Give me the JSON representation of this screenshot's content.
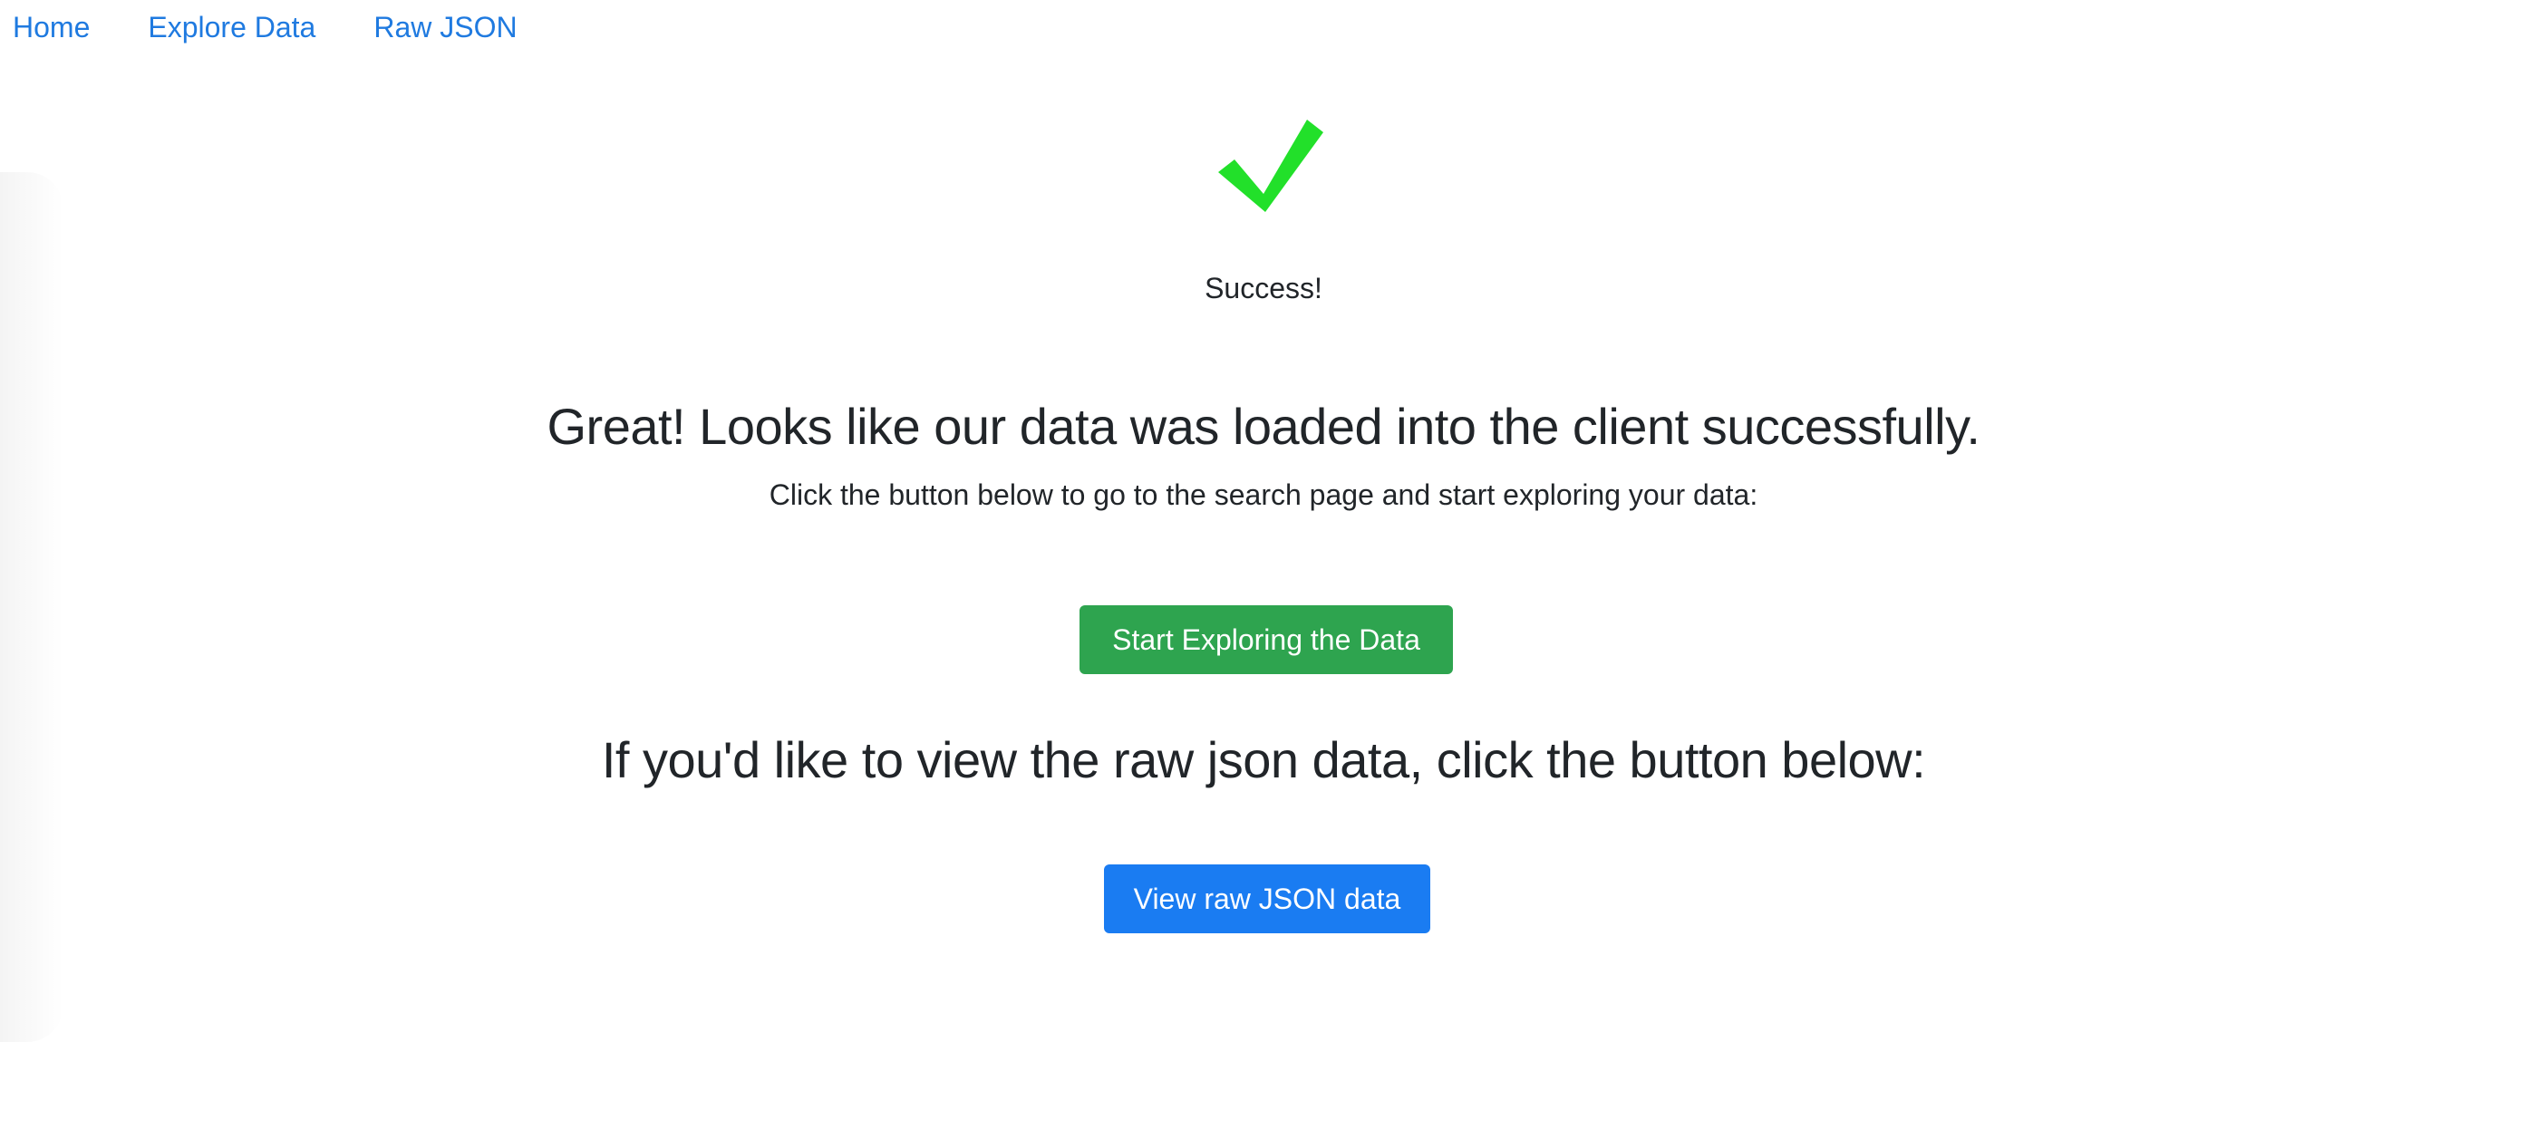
{
  "nav": {
    "items": [
      {
        "label": "Home"
      },
      {
        "label": "Explore Data"
      },
      {
        "label": "Raw JSON"
      }
    ]
  },
  "status": {
    "icon": "checkmark-icon",
    "icon_color": "#22e02a",
    "text": "Success!"
  },
  "main": {
    "headline": "Great! Looks like our data was loaded into the client successfully.",
    "subline": "Click the button below to go to the search page and start exploring your data:",
    "explore_button": "Start Exploring the Data",
    "raw_headline": "If you'd like to view the raw json data, click the button below:",
    "raw_button": "View raw JSON data"
  },
  "colors": {
    "link": "#1f7ae0",
    "success_button": "#2ea44f",
    "primary_button": "#1a7cf2",
    "text": "#212529"
  }
}
